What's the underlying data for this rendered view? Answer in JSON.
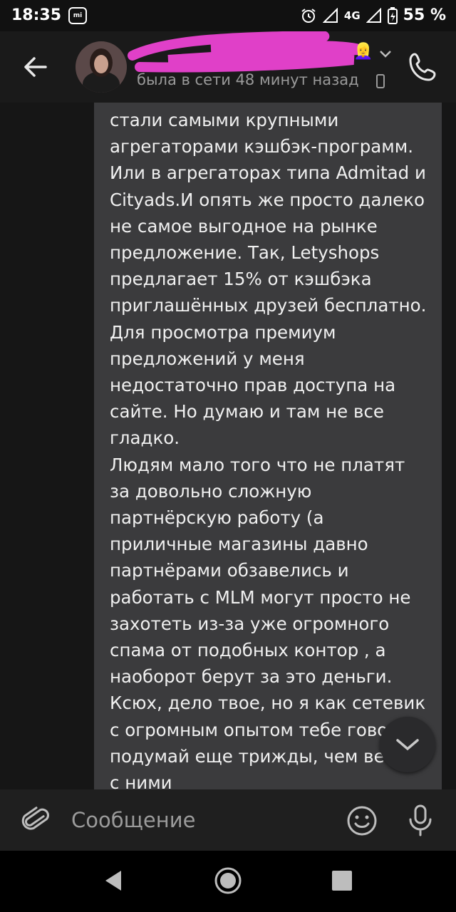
{
  "status_bar": {
    "time": "18:35",
    "network": "4G",
    "battery": "55 %"
  },
  "header": {
    "last_seen": "была в сети 48 минут назад",
    "name_emoji": "👱‍♀️"
  },
  "message": {
    "paragraphs": [
      "стали самыми крупными агрегаторами кэшбэк-программ. Или в агрегаторах типа Admitad и Cityads.И опять же просто далеко не самое выгодное на рынке предложение. Так, Letyshops предлагает 15% от кэшбэка приглашённых друзей бесплатно. Для просмотра премиум предложений у меня недостаточно прав доступа на сайте. Но думаю и там не все гладко.",
      "Людям мало того что не платят за довольно сложную партнёрскую работу (а приличные магазины давно партнёрами обзавелись и работать с MLM могут просто не захотеть из-за уже огромного спама от подобных контор , а наоборот берут за это деньги.",
      "Ксюх, дело твое, но я как сетевик с огромным опытом тебе говорю подумай еще трижды, чем вести с ними"
    ]
  },
  "input": {
    "placeholder": "Сообщение"
  },
  "colors": {
    "bubble": "#3b3b3d",
    "background": "#161616",
    "redaction": "#e040c8"
  }
}
